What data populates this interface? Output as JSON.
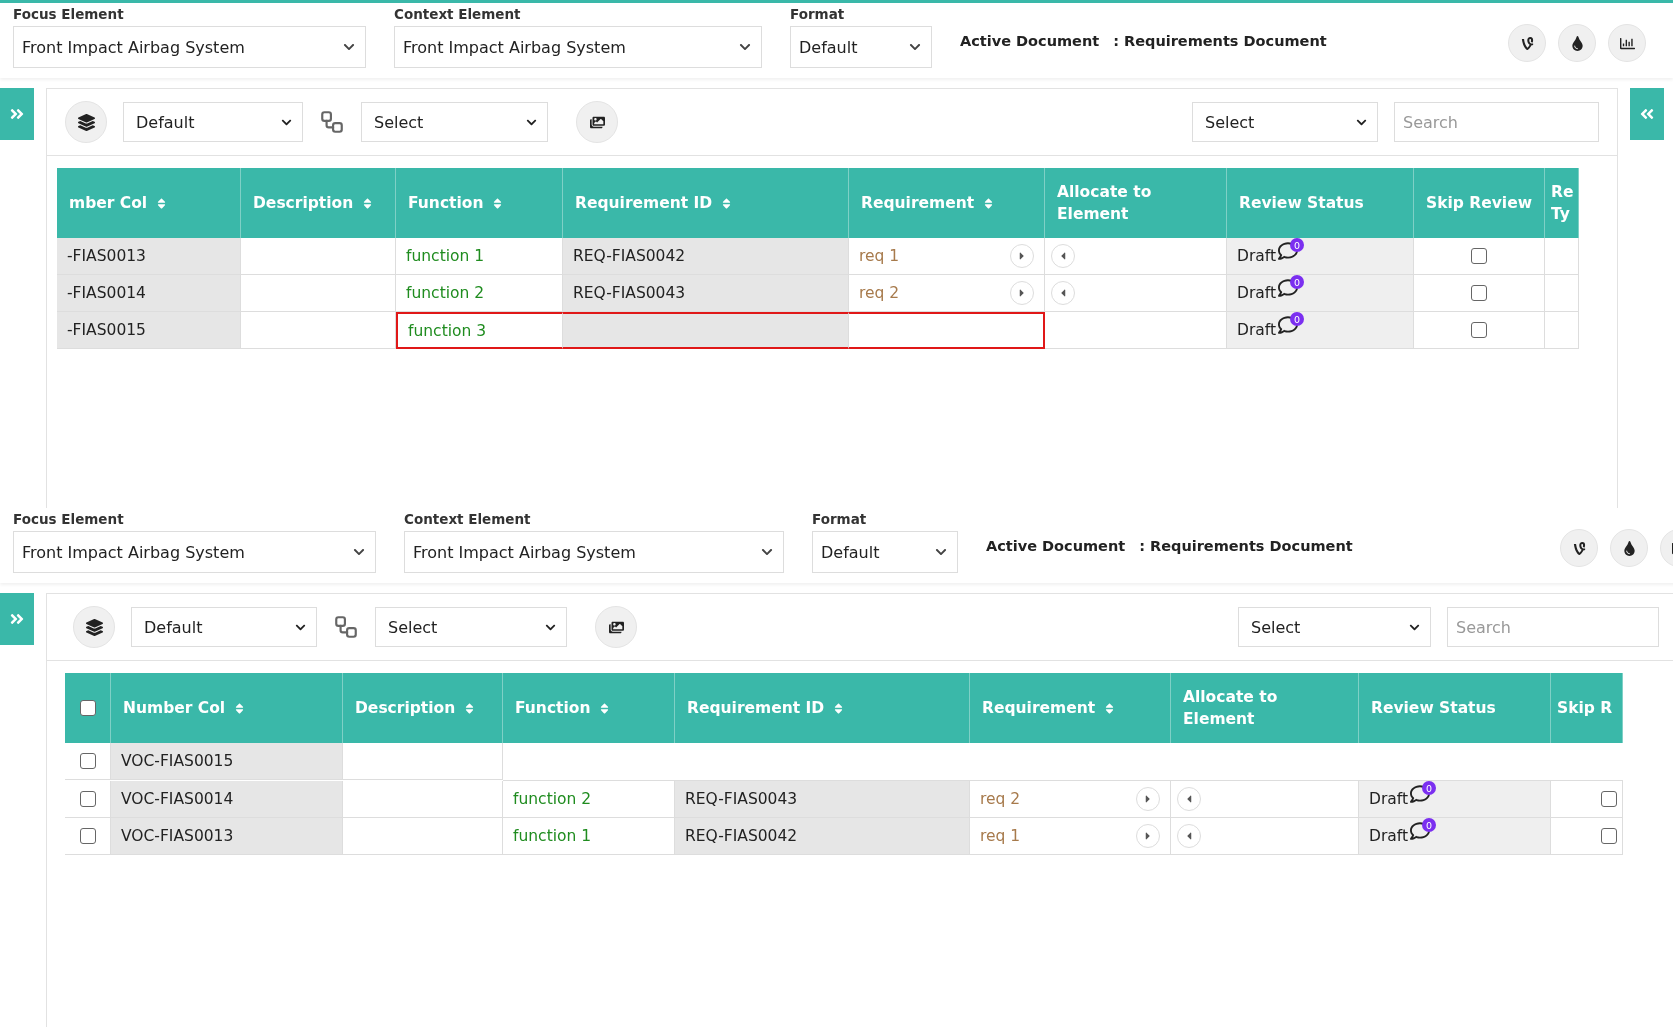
{
  "panels": [
    {
      "focus_element": {
        "label": "Focus Element",
        "value": "Front Impact Airbag System"
      },
      "context_element": {
        "label": "Context Element",
        "value": "Front Impact Airbag System"
      },
      "format": {
        "label": "Format",
        "value": "Default"
      },
      "active_document": {
        "label": "Active Document",
        "value": ": Requirements Document"
      },
      "right_toggle": true,
      "toolbar": {
        "view_select": "Default",
        "flow_select": "Select",
        "filter_select": "Select",
        "search_placeholder": "Search"
      },
      "table": {
        "select_column": false,
        "columns": [
          {
            "label": "mber Col",
            "sortable": true
          },
          {
            "label": "Description",
            "sortable": true
          },
          {
            "label": "Function",
            "sortable": true
          },
          {
            "label": "Requirement ID",
            "sortable": true
          },
          {
            "label": "Requirement",
            "sortable": true
          },
          {
            "label": "Allocate to Element",
            "sortable": false
          },
          {
            "label": "Review Status",
            "sortable": false
          },
          {
            "label": "Skip Review",
            "sortable": false
          },
          {
            "label": "Re Ty"
          }
        ],
        "rows": [
          {
            "kind": "full",
            "number": "-FIAS0013",
            "function": "function 1",
            "requirement_id": "REQ-FIAS0042",
            "requirement": "req 1",
            "review_status": "Draft",
            "comment_count": "0",
            "skip_review": false,
            "highlighted": false
          },
          {
            "kind": "full",
            "number": "-FIAS0014",
            "function": "function 2",
            "requirement_id": "REQ-FIAS0043",
            "requirement": "req 2",
            "review_status": "Draft",
            "comment_count": "0",
            "skip_review": false,
            "highlighted": false
          },
          {
            "kind": "full",
            "number": "-FIAS0015",
            "function": "function 3",
            "review_status": "Draft",
            "comment_count": "0",
            "skip_review": false,
            "highlighted": true
          }
        ]
      }
    },
    {
      "focus_element": {
        "label": "Focus Element",
        "value": "Front Impact Airbag System"
      },
      "context_element": {
        "label": "Context Element",
        "value": "Front Impact Airbag System"
      },
      "format": {
        "label": "Format",
        "value": "Default"
      },
      "active_document": {
        "label": "Active Document",
        "value": ": Requirements Document"
      },
      "right_toggle": false,
      "toolbar": {
        "view_select": "Default",
        "flow_select": "Select",
        "filter_select": "Select",
        "search_placeholder": "Search"
      },
      "table": {
        "select_column": true,
        "select_all_checked": false,
        "columns": [
          {
            "label": "Number Col",
            "sortable": true
          },
          {
            "label": "Description",
            "sortable": true
          },
          {
            "label": "Function",
            "sortable": true
          },
          {
            "label": "Requirement ID",
            "sortable": true
          },
          {
            "label": "Requirement",
            "sortable": true
          },
          {
            "label": "Allocate to Element",
            "sortable": false
          },
          {
            "label": "Review Status",
            "sortable": false
          },
          {
            "label": "Skip R",
            "sortable": false
          }
        ],
        "rows": [
          {
            "kind": "stub",
            "checked": false,
            "number": "VOC-FIAS0015"
          },
          {
            "kind": "full",
            "checked": false,
            "number": "VOC-FIAS0014",
            "function": "function 2",
            "requirement_id": "REQ-FIAS0043",
            "requirement": "req 2",
            "review_status": "Draft",
            "comment_count": "0",
            "skip_review": false,
            "highlighted": false
          },
          {
            "kind": "full",
            "checked": false,
            "number": "VOC-FIAS0013",
            "function": "function 1",
            "requirement_id": "REQ-FIAS0042",
            "requirement": "req 1",
            "review_status": "Draft",
            "comment_count": "0",
            "skip_review": false,
            "highlighted": false
          }
        ]
      }
    }
  ]
}
